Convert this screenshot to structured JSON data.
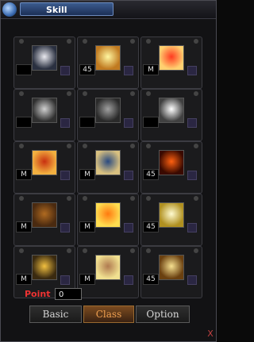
{
  "window": {
    "title": "Skill"
  },
  "skills": [
    {
      "level": "",
      "colors": [
        "#e9e9ef",
        "#2a3040"
      ]
    },
    {
      "level": "45",
      "colors": [
        "#fff6a0",
        "#c07a20"
      ]
    },
    {
      "level": "M",
      "colors": [
        "#ff3a20",
        "#ffd070"
      ]
    },
    {
      "level": "",
      "colors": [
        "#d0d0d0",
        "#303030"
      ]
    },
    {
      "level": "",
      "colors": [
        "#a0a0a0",
        "#2a2a2a"
      ]
    },
    {
      "level": "",
      "colors": [
        "#ffffff",
        "#404040"
      ]
    },
    {
      "level": "M",
      "colors": [
        "#c83010",
        "#f2b040"
      ]
    },
    {
      "level": "M",
      "colors": [
        "#2a4a80",
        "#d8c080"
      ]
    },
    {
      "level": "45",
      "colors": [
        "#ff6010",
        "#3a0a00"
      ]
    },
    {
      "level": "M",
      "colors": [
        "#b06a20",
        "#4a2a10"
      ]
    },
    {
      "level": "M",
      "colors": [
        "#ff7a10",
        "#ffdd50"
      ]
    },
    {
      "level": "45",
      "colors": [
        "#fffbd0",
        "#b09020"
      ]
    },
    {
      "level": "M",
      "colors": [
        "#f2c040",
        "#3a2a10"
      ]
    },
    {
      "level": "M",
      "colors": [
        "#b07a50",
        "#f0e090"
      ]
    },
    {
      "level": "45",
      "colors": [
        "#f6e090",
        "#6a4010"
      ]
    }
  ],
  "points": {
    "label": "Point",
    "value": "0"
  },
  "tabs": [
    {
      "label": "Basic",
      "active": false
    },
    {
      "label": "Class",
      "active": true
    },
    {
      "label": "Option",
      "active": false
    }
  ],
  "close_label": "X"
}
